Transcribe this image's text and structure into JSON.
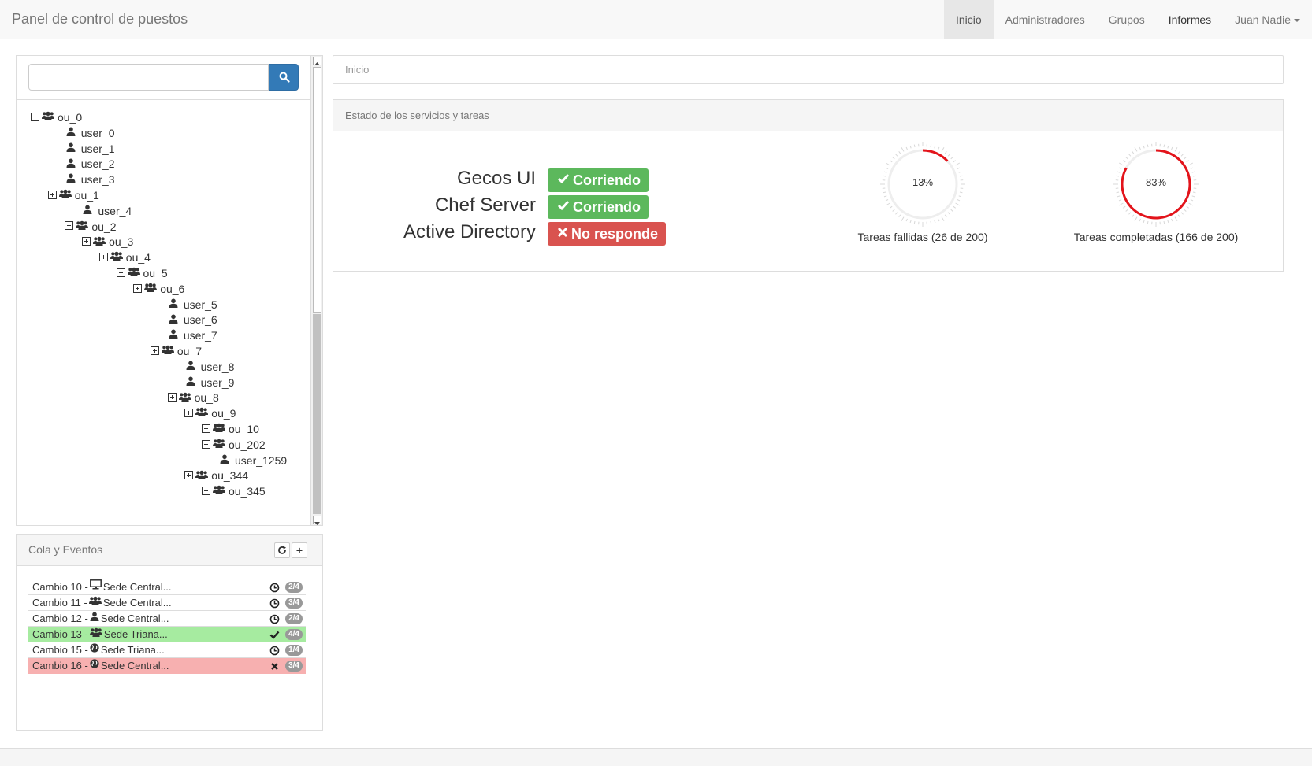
{
  "navbar": {
    "brand": "Panel de control de puestos",
    "items": [
      {
        "label": "Inicio"
      },
      {
        "label": "Administradores"
      },
      {
        "label": "Grupos"
      },
      {
        "label": "Informes"
      },
      {
        "label": "Juan Nadie"
      }
    ]
  },
  "search": {
    "value": "",
    "placeholder": ""
  },
  "tree": [
    {
      "label": "ou_0",
      "type": "ou",
      "depth": 0
    },
    {
      "label": "user_0",
      "type": "user",
      "depth": 1
    },
    {
      "label": "user_1",
      "type": "user",
      "depth": 1
    },
    {
      "label": "user_2",
      "type": "user",
      "depth": 1
    },
    {
      "label": "user_3",
      "type": "user",
      "depth": 1
    },
    {
      "label": "ou_1",
      "type": "ou",
      "depth": 1
    },
    {
      "label": "user_4",
      "type": "user",
      "depth": 2
    },
    {
      "label": "ou_2",
      "type": "ou",
      "depth": 2
    },
    {
      "label": "ou_3",
      "type": "ou",
      "depth": 3
    },
    {
      "label": "ou_4",
      "type": "ou",
      "depth": 4
    },
    {
      "label": "ou_5",
      "type": "ou",
      "depth": 5
    },
    {
      "label": "ou_6",
      "type": "ou",
      "depth": 6
    },
    {
      "label": "user_5",
      "type": "user",
      "depth": 7
    },
    {
      "label": "user_6",
      "type": "user",
      "depth": 7
    },
    {
      "label": "user_7",
      "type": "user",
      "depth": 7
    },
    {
      "label": "ou_7",
      "type": "ou",
      "depth": 7
    },
    {
      "label": "user_8",
      "type": "user",
      "depth": 8
    },
    {
      "label": "user_9",
      "type": "user",
      "depth": 8
    },
    {
      "label": "ou_8",
      "type": "ou",
      "depth": 8
    },
    {
      "label": "ou_9",
      "type": "ou",
      "depth": 9
    },
    {
      "label": "ou_10",
      "type": "ou",
      "depth": 10
    },
    {
      "label": "ou_202",
      "type": "ou",
      "depth": 10
    },
    {
      "label": "user_1259",
      "type": "user",
      "depth": 10
    },
    {
      "label": "ou_344",
      "type": "ou",
      "depth": 9
    },
    {
      "label": "ou_345",
      "type": "ou",
      "depth": 10
    }
  ],
  "queue": {
    "title": "Cola y Eventos",
    "refresh_icon": "refresh-icon",
    "add_icon": "plus-icon",
    "add_label": "+",
    "items": [
      {
        "change": "Cambio 10 -",
        "icon": "desktop-icon",
        "site": "Sede Central...",
        "status": "pending",
        "progress": "2/4"
      },
      {
        "change": "Cambio 11 -",
        "icon": "group-icon",
        "site": "Sede Central...",
        "status": "pending",
        "progress": "3/4"
      },
      {
        "change": "Cambio 12 -",
        "icon": "user-icon",
        "site": "Sede Central...",
        "status": "pending",
        "progress": "2/4"
      },
      {
        "change": "Cambio 13 -",
        "icon": "group-icon",
        "site": "Sede Triana...",
        "status": "ok",
        "progress": "4/4"
      },
      {
        "change": "Cambio 15 -",
        "icon": "globe-icon",
        "site": "Sede Triana...",
        "status": "pending",
        "progress": "1/4"
      },
      {
        "change": "Cambio 16 -",
        "icon": "globe-icon",
        "site": "Sede Central...",
        "status": "error",
        "progress": "3/4"
      }
    ]
  },
  "breadcrumb": {
    "label": "Inicio"
  },
  "status_panel": {
    "title": "Estado de los servicios y tareas",
    "services": [
      {
        "name": "Gecos UI",
        "status": "Corriendo",
        "state": "running"
      },
      {
        "name": "Chef Server",
        "status": "Corriendo",
        "state": "running"
      },
      {
        "name": "Active Directory",
        "status": "No responde",
        "state": "failed"
      }
    ],
    "gauges": [
      {
        "percent_label": "13%",
        "fraction": 0.13,
        "label": "Tareas fallidas (26 de 200)"
      },
      {
        "percent_label": "83%",
        "fraction": 0.83,
        "label": "Tareas completadas (166 de 200)"
      }
    ]
  },
  "colors": {
    "primary": "#337ab7",
    "success": "#5cb85c",
    "danger": "#d9534f",
    "gauge_arc": "#e3141b",
    "row_ok": "#a6eba0",
    "row_error": "#f7b0b0"
  }
}
